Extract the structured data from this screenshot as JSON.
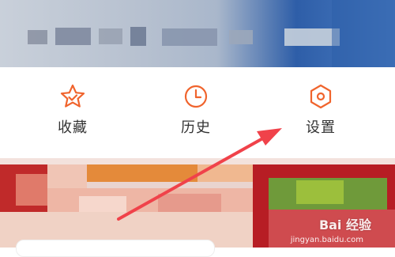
{
  "nav": {
    "items": [
      {
        "label": "收藏",
        "icon": "star-icon"
      },
      {
        "label": "历史",
        "icon": "clock-icon"
      },
      {
        "label": "设置",
        "icon": "settings-hexagon-icon"
      }
    ]
  },
  "watermark": {
    "logo_text": "Bai 经验",
    "sub_text": "jingyan.baidu.com"
  },
  "colors": {
    "accent": "#f0642d",
    "annotation_arrow": "#f0424a",
    "label_text": "#333333"
  }
}
